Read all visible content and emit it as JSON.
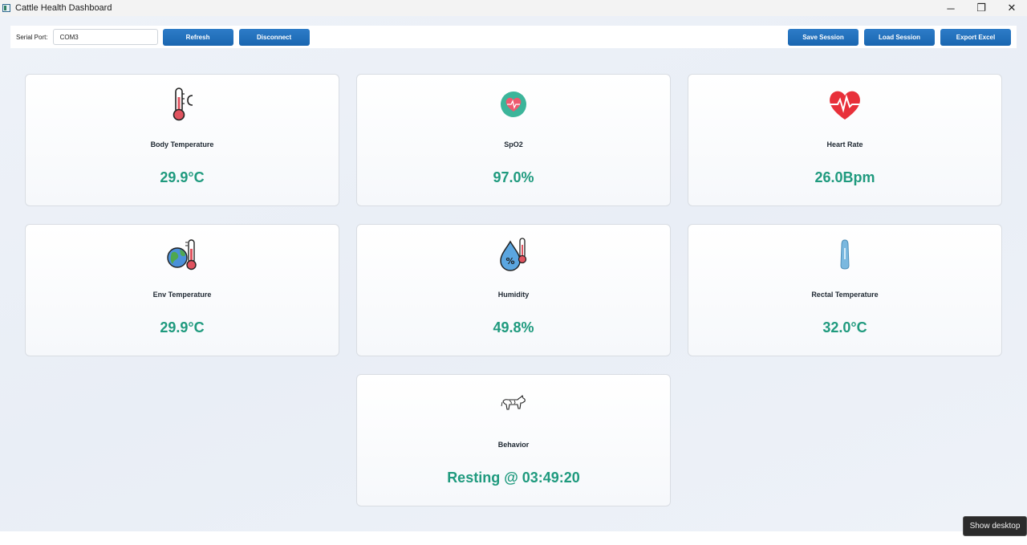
{
  "window": {
    "title": "Cattle Health Dashboard",
    "controls": {
      "minimize": "─",
      "restore": "❐",
      "close": "✕"
    }
  },
  "toolbar": {
    "serial_label": "Serial Port:",
    "serial_value": "COM3",
    "refresh_label": "Refresh",
    "disconnect_label": "Disconnect",
    "save_label": "Save Session",
    "load_label": "Load Session",
    "export_label": "Export Excel"
  },
  "cards": [
    {
      "label": "Body Temperature",
      "value": "29.9°C",
      "icon": "thermometer-icon"
    },
    {
      "label": "SpO2",
      "value": "97.0%",
      "icon": "spo2-heart-icon"
    },
    {
      "label": "Heart Rate",
      "value": "26.0Bpm",
      "icon": "heart-pulse-icon"
    },
    {
      "label": "Env Temperature",
      "value": "29.9°C",
      "icon": "globe-thermometer-icon"
    },
    {
      "label": "Humidity",
      "value": "49.8%",
      "icon": "humidity-drop-icon"
    },
    {
      "label": "Rectal Temperature",
      "value": "32.0°C",
      "icon": "rectal-probe-icon"
    },
    {
      "label": "Behavior",
      "value": "Resting @ 03:49:20",
      "icon": "cow-icon"
    }
  ],
  "colors": {
    "accent_button": "#1f6fbd",
    "value_text": "#1f9a7e"
  },
  "tooltip": "Show desktop"
}
